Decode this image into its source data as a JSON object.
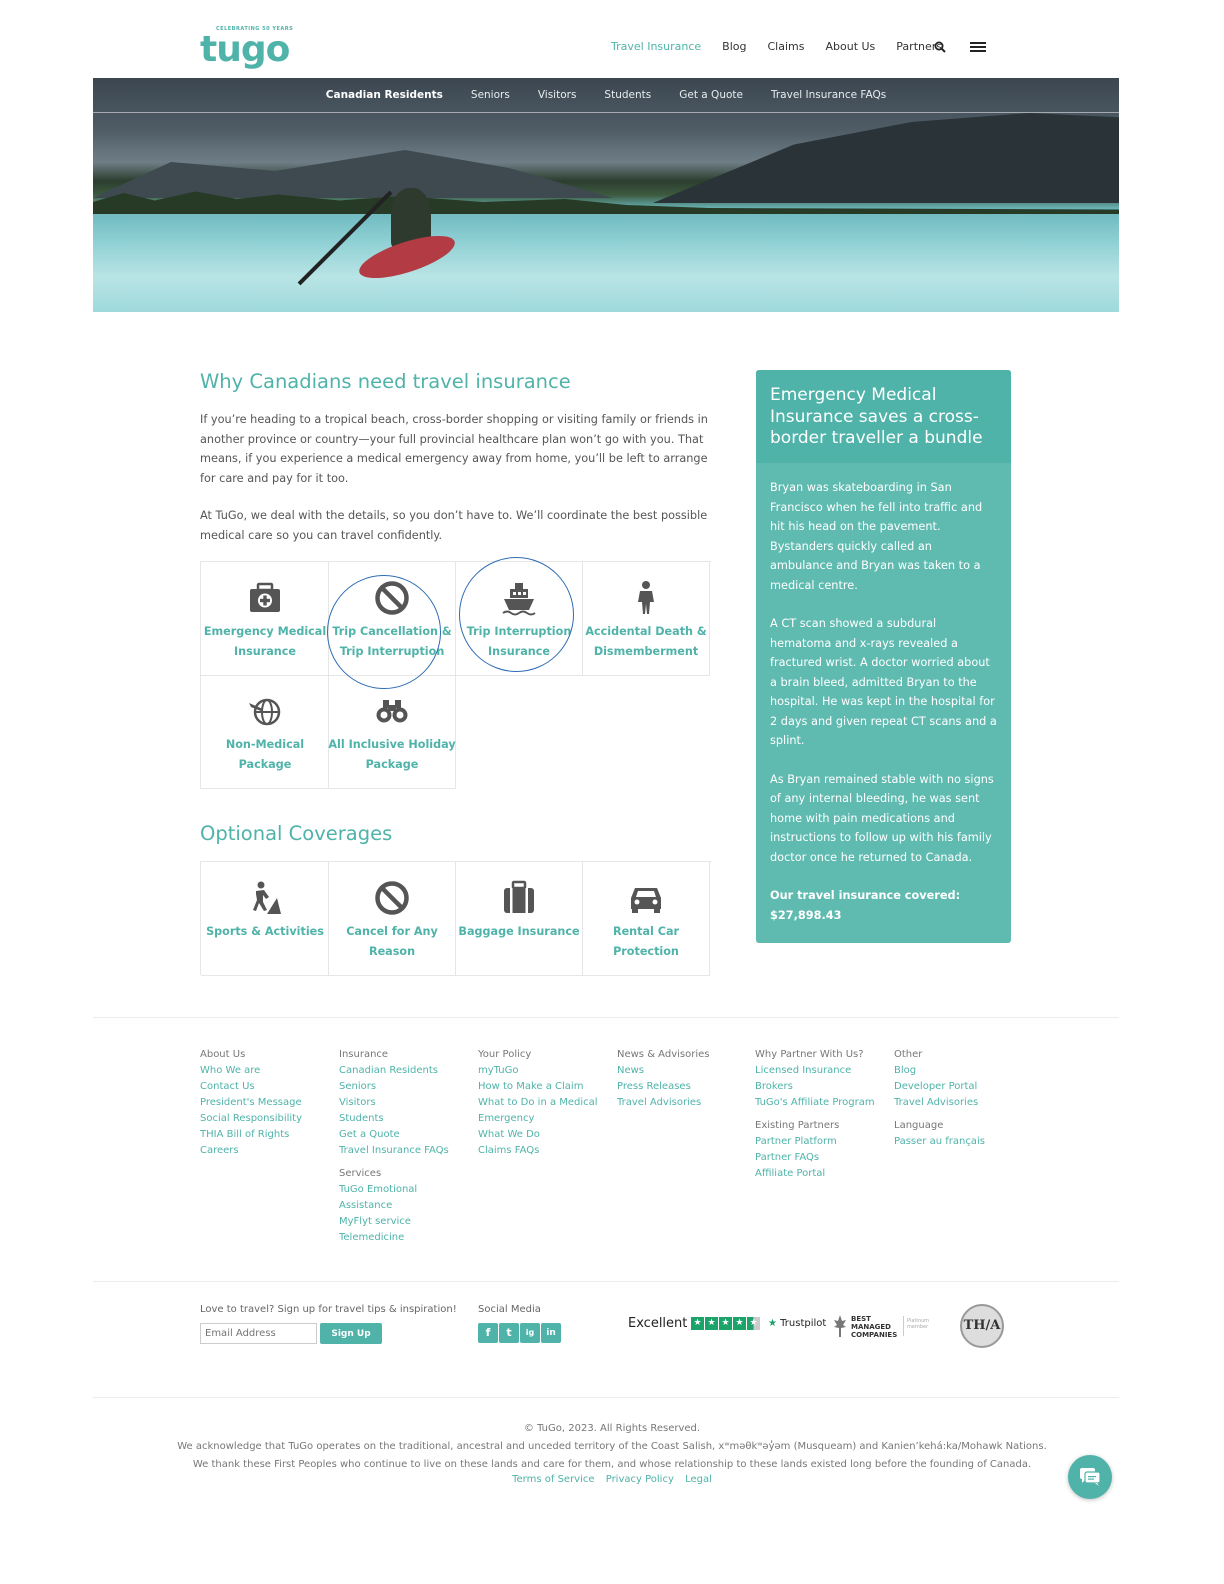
{
  "header": {
    "logo_tagline": "CELEBRATING 50 YEARS",
    "logo_word": "tugo",
    "nav": [
      "Travel Insurance",
      "Blog",
      "Claims",
      "About Us",
      "Partners"
    ],
    "search_icon": "search-icon",
    "menu_icon": "hamburger-menu-icon"
  },
  "subnav": [
    "Canadian Residents",
    "Seniors",
    "Visitors",
    "Students",
    "Get a Quote",
    "Travel Insurance FAQs"
  ],
  "main": {
    "heading": "Why Canadians need travel insurance",
    "para1": "If you’re heading to a tropical beach, cross-border shopping or visiting family or friends in another province or country—your full provincial healthcare plan won’t go with you. That means, if you experience a medical emergency away from home, you’ll be left to arrange for care and pay for it too.",
    "para2": "At TuGo, we deal with the details, so you don’t have to. We’ll coordinate the best possible medical care so you can travel confidently.",
    "products": [
      {
        "label": "Emergency Medical Insurance",
        "icon": "medical-kit-icon"
      },
      {
        "label": "Trip Cancellation & Trip Interruption",
        "icon": "prohibited-icon"
      },
      {
        "label": "Trip Interruption Insurance",
        "icon": "ship-icon"
      },
      {
        "label": "Accidental Death & Dismemberment",
        "icon": "person-icon"
      },
      {
        "label": "Non-Medical Package",
        "icon": "globe-plane-icon"
      },
      {
        "label": "All Inclusive Holiday Package",
        "icon": "binoculars-icon"
      }
    ],
    "optional_heading": "Optional Coverages",
    "optional": [
      {
        "label": "Sports & Activities",
        "icon": "hiker-icon"
      },
      {
        "label": "Cancel for Any Reason",
        "icon": "prohibited-icon"
      },
      {
        "label": "Baggage Insurance",
        "icon": "luggage-icon"
      },
      {
        "label": "Rental Car Protection",
        "icon": "car-icon"
      }
    ]
  },
  "sidebar": {
    "title": "Emergency Medical Insurance saves a cross-border traveller a bundle",
    "p1": "Bryan was skateboarding in San Francisco when he fell into traffic and hit his head on the pavement. Bystanders quickly called an ambulance and Bryan was taken to a medical centre.",
    "p2": "A CT scan showed a subdural hematoma and x-rays revealed a fractured wrist. A doctor worried about a brain bleed, admitted Bryan to the hospital. He was kept in the hospital for 2 days and given repeat CT scans and a splint.",
    "p3": "As Bryan remained stable with no signs of any internal bleeding, he was sent home with pain medications and instructions to follow up with his family doctor once he returned to Canada.",
    "covered_label": "Our travel insurance covered:",
    "covered_amount": "$27,898.43"
  },
  "footer": {
    "col1": {
      "h": "About Us",
      "links": [
        "Who We are",
        "Contact Us",
        "President's Message",
        "Social Responsibility",
        "THIA Bill of Rights",
        "Careers"
      ]
    },
    "col2": {
      "h": "Insurance",
      "links": [
        "Canadian Residents",
        "Seniors",
        "Visitors",
        "Students",
        "Get a Quote",
        "Travel Insurance FAQs"
      ],
      "h2": "Services",
      "links2": [
        "TuGo Emotional",
        "Assistance",
        "MyFlyt service",
        "Telemedicine"
      ]
    },
    "col3": {
      "h": "Your Policy",
      "links": [
        "myTuGo",
        "How to Make a Claim",
        "What to Do in a Medical",
        "Emergency",
        "What We Do",
        "Claims FAQs"
      ]
    },
    "col4": {
      "h": "News & Advisories",
      "links": [
        "News",
        "Press Releases",
        "Travel Advisories"
      ]
    },
    "col5": {
      "h": "Why Partner With Us?",
      "links": [
        "Licensed Insurance",
        "Brokers",
        "TuGo's Affiliate Program"
      ],
      "h2": "Existing Partners",
      "links2": [
        "Partner Platform",
        "Partner FAQs",
        "Affiliate Portal"
      ]
    },
    "col6": {
      "h": "Other",
      "links": [
        "Blog",
        "Developer Portal",
        "Travel Advisories"
      ],
      "h2": "Language",
      "links2": [
        "Passer au français"
      ]
    },
    "newsletter_label": "Love to travel? Sign up for travel tips & inspiration!",
    "email_placeholder": "Email Address",
    "signup_label": "Sign Up",
    "social_heading": "Social Media",
    "social": [
      "f",
      "t",
      "ig",
      "in"
    ],
    "trustpilot_rating": "Excellent",
    "trustpilot_name": "Trustpilot",
    "trustpilot_stars": 4.5,
    "bmc_text": "BEST MANAGED COMPANIES",
    "bmc_badge": "Platinum member",
    "thia_text": "TH/A",
    "copyright": "© TuGo, 2023. All Rights Reserved.",
    "ack1": "We acknowledge that TuGo operates on the traditional, ancestral and unceded territory of the Coast Salish, xʷməθkʷəy̓əm (Musqueam) and Kanien’kehá:ka/Mohawk Nations.",
    "ack2": "We thank these First Peoples who continue to live on these lands and care for them, and whose relationship to these lands existed long before the founding of Canada.",
    "legal": [
      "Terms of Service",
      "Privacy Policy",
      "Legal"
    ]
  },
  "colors": {
    "accent": "#4fb3a9",
    "sidebar": "#5fbab0",
    "highlight_ring": "#2f6db5"
  }
}
